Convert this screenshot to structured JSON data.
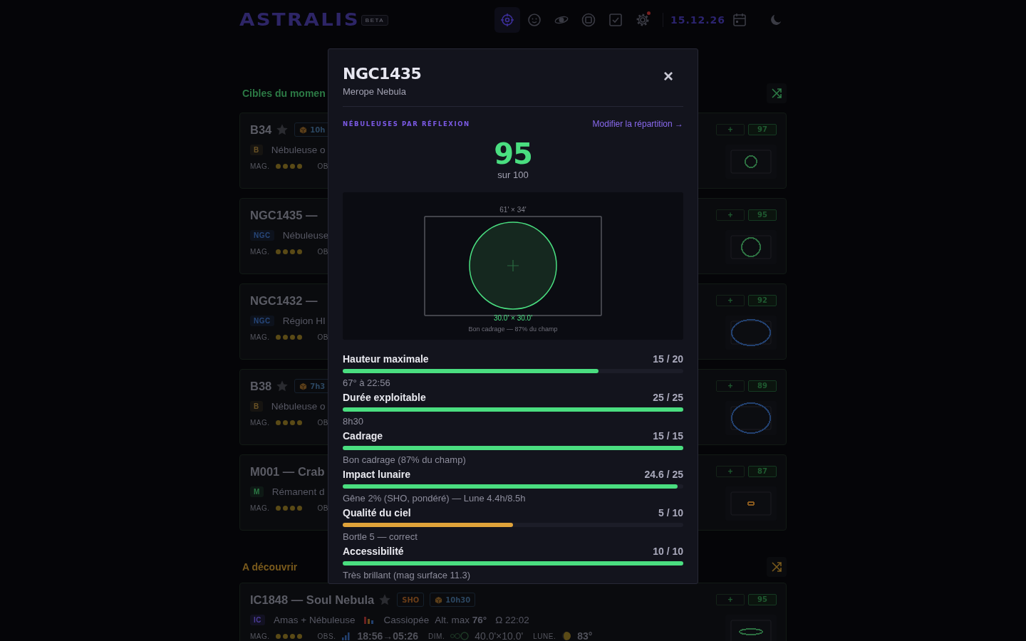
{
  "header": {
    "logo": "ASTRALIS",
    "badge": "BETA",
    "nav": [
      {
        "kind": "target",
        "selected": true
      },
      {
        "kind": "smiley",
        "selected": false
      },
      {
        "kind": "galaxy",
        "selected": false
      },
      {
        "kind": "chip",
        "selected": false
      },
      {
        "kind": "checklist",
        "selected": false
      },
      {
        "kind": "settings",
        "selected": false,
        "alert": true
      }
    ],
    "date": "15.12.26"
  },
  "sections": [
    {
      "title": "Cibles du momen",
      "color": "#2c7a45",
      "cards": [
        {
          "title": "B34",
          "favorite": false,
          "badges": [
            {
              "kind": "duration",
              "text": "10h"
            }
          ],
          "tag": {
            "text": "B",
            "color": "#6a5225"
          },
          "type": "Nébuleuse o",
          "mag_label": "MAG.",
          "stars": 4,
          "obs_label": "OB",
          "add": "+",
          "score": "97",
          "fov": {
            "kind": "dot",
            "color": "#2c6e40"
          }
        },
        {
          "title": "NGC1435 —",
          "tag": {
            "text": "NGC",
            "color": "#27477a"
          },
          "type": "Nébuleuse",
          "mag_label": "MAG.",
          "stars": 4,
          "obs_label": "OB",
          "add": "+",
          "score": "95",
          "fov": {
            "kind": "circle",
            "color": "#2c6e40"
          }
        },
        {
          "title": "NGC1432 —",
          "tag": {
            "text": "NGC",
            "color": "#27477a"
          },
          "type": "Région HI",
          "mag_label": "MAG.",
          "stars": 4,
          "obs_label": "OB",
          "add": "+",
          "score": "92",
          "fov": {
            "kind": "oval",
            "color": "#22406e"
          }
        },
        {
          "title": "B38",
          "favorite": false,
          "badges": [
            {
              "kind": "duration",
              "text": "7h3"
            }
          ],
          "tag": {
            "text": "B",
            "color": "#6a5225"
          },
          "type": "Nébuleuse o",
          "mag_label": "MAG.",
          "stars": 4,
          "obs_label": "OB",
          "add": "+",
          "score": "89",
          "fov": {
            "kind": "blob",
            "color": "#22406e"
          }
        },
        {
          "title": "M001 — Crab",
          "tag": {
            "text": "M",
            "color": "#2c7a45"
          },
          "type": "Rémanent d",
          "mag_label": "MAG.",
          "stars": 4,
          "obs_label": "OB",
          "add": "+",
          "score": "87",
          "fov": {
            "kind": "speck",
            "color": "#8a5a1e"
          }
        }
      ]
    },
    {
      "title": "A découvrir",
      "color": "#7a5a1c",
      "cards": [
        {
          "title": "IC1848 — Soul Nebula",
          "favorite": false,
          "badges": [
            {
              "kind": "filter",
              "text": "SHO"
            },
            {
              "kind": "duration",
              "text": "10h30"
            }
          ],
          "tag": {
            "text": "IC",
            "color": "#4c3c9a"
          },
          "type": "Amas + Nébuleuse",
          "constellation": "Cassiopée",
          "altitude": "Alt. max **76°**",
          "transit": "Ω 22:02",
          "mag_label": "MAG.",
          "stars": 4,
          "obs_label": "OBS.",
          "obs_window": "18:56→05:26",
          "dim_label": "DIM.",
          "dimensions": "40.0'×10.0'",
          "moon_label": "LUNE.",
          "moon": "83°",
          "add": "+",
          "score": "95",
          "fov": {
            "kind": "band",
            "color": "#2c6e40"
          }
        }
      ]
    }
  ],
  "modal": {
    "title": "NGC1435",
    "subtitle": "Merope Nebula",
    "close": "×",
    "category": "NÉBULEUSES PAR RÉFLEXION",
    "edit_link": "Modifier la répartition →",
    "score": "95",
    "score_caption": "sur 100",
    "fov": {
      "sensor": "61' × 34'",
      "object": "30.0' × 30.0'",
      "verdict": "Bon cadrage — 87% du champ"
    },
    "criteria": [
      {
        "label": "Hauteur maximale",
        "score": "15 / 20",
        "level": 0.75,
        "note": "67° à 22:56",
        "color": "#4ade80"
      },
      {
        "label": "Durée exploitable",
        "score": "25 / 25",
        "level": 1,
        "note": "8h30",
        "color": "#4ade80"
      },
      {
        "label": "Cadrage",
        "score": "15 / 15",
        "level": 1,
        "note": "Bon cadrage (87% du champ)",
        "color": "#4ade80"
      },
      {
        "label": "Impact lunaire",
        "score": "24.6 / 25",
        "level": 0.984,
        "note": "Gêne 2% (SHO, pondéré) — Lune 4.4h/8.5h",
        "color": "#4ade80"
      },
      {
        "label": "Qualité du ciel",
        "score": "5 / 10",
        "level": 0.5,
        "note": "Bortle 5 — correct",
        "color": "#e0a33a"
      },
      {
        "label": "Accessibilité",
        "score": "10 / 10",
        "level": 1,
        "note": "Très brillant (mag surface 11.3)",
        "color": "#4ade80"
      }
    ]
  }
}
